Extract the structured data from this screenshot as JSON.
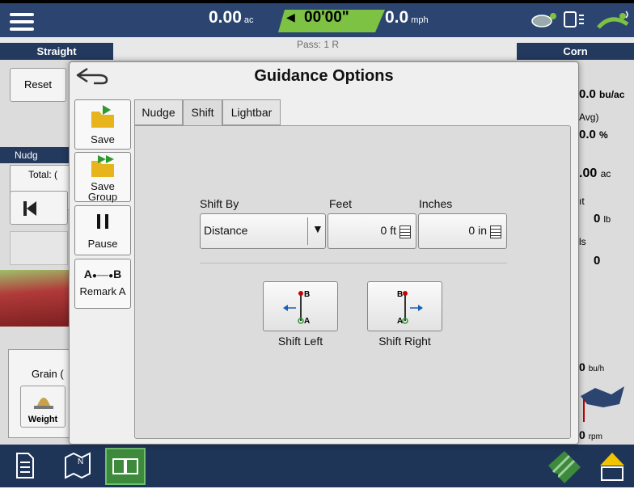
{
  "topbar": {
    "area_value": "0.00",
    "area_unit": "ac",
    "timer": "00'00\"",
    "speed_value": "0.0",
    "speed_unit": "mph"
  },
  "pass_label": "Pass: 1 R",
  "tabs_bar": {
    "left": "Straight",
    "right": "Corn"
  },
  "background": {
    "reset": "Reset",
    "nudge_label": "Nudg",
    "total_label": "Total: (",
    "grain_label": "Grain (",
    "weight_label": "Weight",
    "right_yield": "0.0",
    "right_yield_unit": "bu/ac",
    "right_avg_label": "Avg)",
    "right_pct": "0.0",
    "right_pct_unit": "%",
    "right_area": ".00",
    "right_area_unit": "ac",
    "right_ht": "ıt",
    "right_lb": "0",
    "right_lb_unit": "lb",
    "right_ls": "ls",
    "right_zero": "0",
    "right_buh": "0",
    "right_buh_unit": "bu/h",
    "right_rpm": "0",
    "right_rpm_unit": "rpm"
  },
  "modal": {
    "title": "Guidance Options",
    "side_buttons": {
      "save": "Save",
      "save_group_1": "Save",
      "save_group_2": "Group",
      "pause": "Pause",
      "remark": "Remark A",
      "ab_a": "A",
      "ab_b": "B"
    },
    "tabs": [
      "Nudge",
      "Shift",
      "Lightbar"
    ],
    "active_tab": "Shift",
    "shift_by_label": "Shift By",
    "shift_by_value": "Distance",
    "feet_label": "Feet",
    "feet_value": "0 ft",
    "inches_label": "Inches",
    "inches_value": "0 in",
    "shift_left": "Shift Left",
    "shift_right": "Shift Right",
    "icon_a": "A",
    "icon_b": "B"
  },
  "colors": {
    "topbar": "#2b4570",
    "timer_green": "#7dc242",
    "modal_bg": "#efefef",
    "panel_bg": "#dcdcdc"
  }
}
